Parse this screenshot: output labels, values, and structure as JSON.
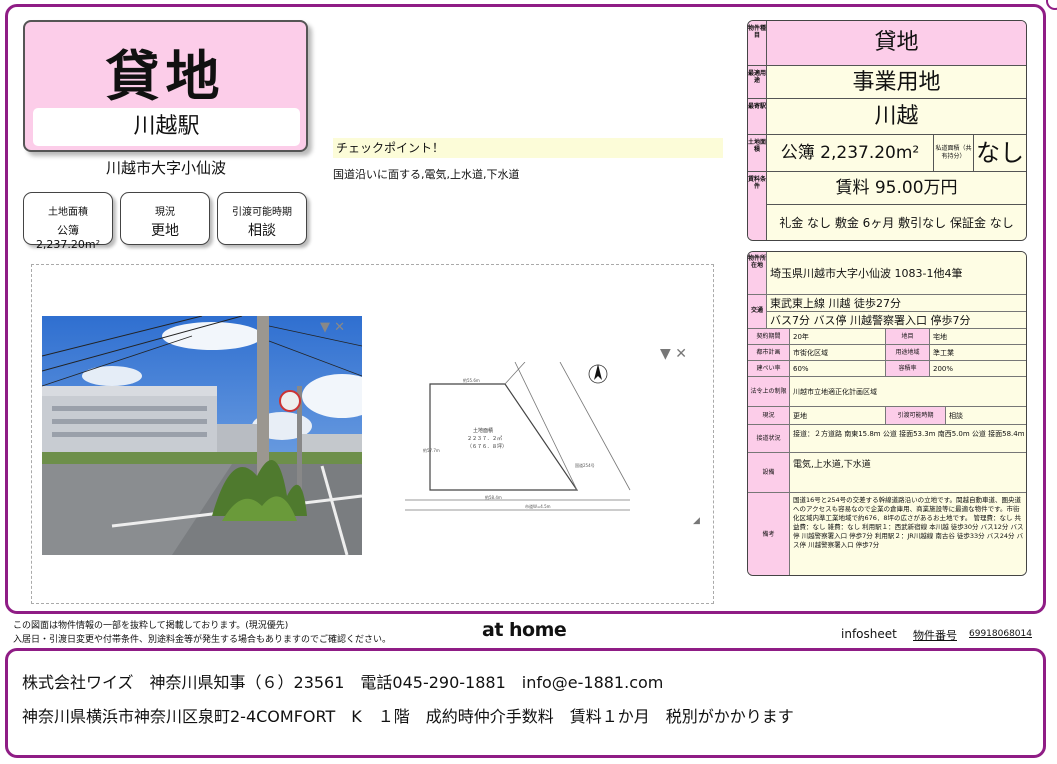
{
  "property": {
    "type": "貸地",
    "station": "川越駅",
    "address_short": "川越市大字小仙波"
  },
  "summary": {
    "area_label": "土地面積",
    "area_value": "公簿 2,237.20m²",
    "status_label": "現況",
    "status_value": "更地",
    "move_label": "引渡可能時期",
    "move_value": "相談"
  },
  "checkpoint": {
    "heading": "チェックポイント！",
    "body": "国道沿いに面する,電気,上水道,下水道"
  },
  "map": {
    "area_title": "土地面積",
    "area_value": "２２３７．２㎡",
    "area_tsubo": "（６７６．８坪）"
  },
  "right_table": {
    "labels": [
      "物件種目",
      "最適用途",
      "最寄駅",
      "土地面積",
      "賃料条件"
    ],
    "type": "貸地",
    "use": "事業用地",
    "station": "川越",
    "area": "公簿 2,237.20m²",
    "private_road_label": "私道面積（共有持分）",
    "private_road": "なし",
    "rent": "賃料 95.00万円",
    "conditions": "礼金 なし 敷金 6ヶ月 敷引なし 保証金 なし"
  },
  "details": {
    "location_label": "物件所在地",
    "location": "埼玉県川越市大字小仙波 1083-1他4筆",
    "traffic_label": "交通",
    "traffic1": "東武東上線 川越 徒歩27分",
    "traffic2": "バス7分 バス停 川越警察署入口 停歩7分",
    "contract_label": "契約期間",
    "contract": "20年",
    "land_label": "地目",
    "land": "宅地",
    "city_label": "都市計画",
    "city": "市街化区域",
    "zone_label": "用途地域",
    "zone": "準工業",
    "coverage_label": "建ぺい率",
    "coverage": "60%",
    "far_label": "容積率",
    "far": "200%",
    "restrict_label": "法令上の制限",
    "restrict": "川越市立地適正化計画区域",
    "status_label": "現況",
    "status": "更地",
    "handover_label": "引渡可能時期",
    "handover": "相談",
    "road_label": "接道状況",
    "road": "接道：２方道路 南東15.8m 公道 接面53.3m 南西5.0m 公道 接面58.4m",
    "facility_label": "設備",
    "facility": "電気,上水道,下水道",
    "remarks_label": "備考",
    "remarks": "国道16号と254号の交差する幹線道路沿いの立地です。関越自動車道、圏央道へのアクセスも容易なので企業の倉庫用、商業施設等に最適な物件です。市街化区域内準工業地域で約676．8坪の広さがあるお土地です。 管理費：なし 共益費：なし 雑費：なし 利用駅１：西武新宿線 本川越 徒歩30分 バス12分 バス停 川越警察署入口 停歩7分 利用駅２：JR川越線 南古谷 徒歩33分 バス24分 バス停 川越警察署入口 停歩7分"
  },
  "footer": {
    "note1": "この図面は物件情報の一部を抜粋して掲載しております。(現況優先)",
    "note2": "入居日・引渡日変更や付帯条件、別途料金等が発生する場合もありますのでご確認ください。",
    "logo": "at home",
    "infosheet": "infosheet",
    "prop_label": "物件番号",
    "prop_no": "69918068014"
  },
  "company": {
    "line1": "株式会社ワイズ　神奈川県知事（６）23561　電話045-290-1881　info@e-1881.com",
    "line2": "神奈川県横浜市神奈川区泉町2-4COMFORT　K　１階　成約時仲介手数料　賃料１か月　税別がかかります"
  },
  "colors": {
    "frame": "#8f1d85",
    "pink": "#fccde9",
    "cream": "#fefde4",
    "check": "#fcfcd8"
  }
}
